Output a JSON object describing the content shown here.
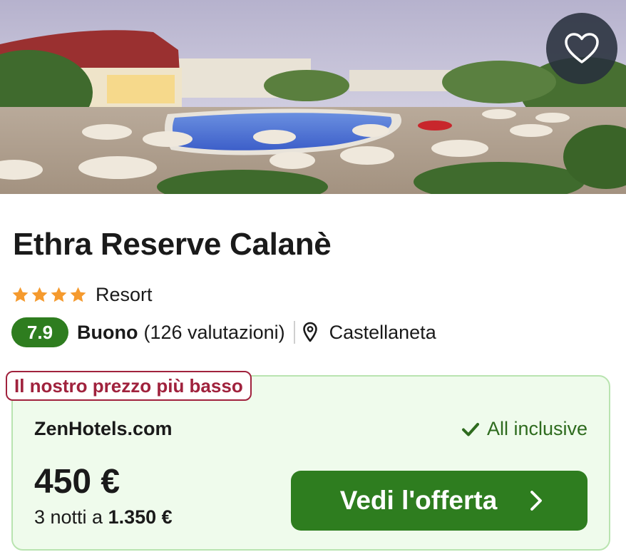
{
  "hotel": {
    "name": "Ethra Reserve Calanè",
    "stars": 4,
    "category": "Resort",
    "score": "7.9",
    "score_word": "Buono",
    "reviews": "(126 valutazioni)",
    "location": "Castellaneta"
  },
  "offer": {
    "tag": "Il nostro prezzo più basso",
    "provider": "ZenHotels.com",
    "board": "All inclusive",
    "price": "450 €",
    "nights_prefix": "3 notti a",
    "total": "1.350 €",
    "cta_label": "Vedi l'offerta"
  },
  "icons": {
    "favorite": "heart-outline-icon",
    "star": "star-icon",
    "location": "map-pin-icon",
    "check": "check-icon",
    "chevron": "chevron-right-icon"
  },
  "colors": {
    "primary_green": "#2e7d1f",
    "offer_bg": "#effbec",
    "offer_border": "#b9e4b0",
    "tag_red": "#a0223d",
    "star_orange": "#f59a2e"
  }
}
